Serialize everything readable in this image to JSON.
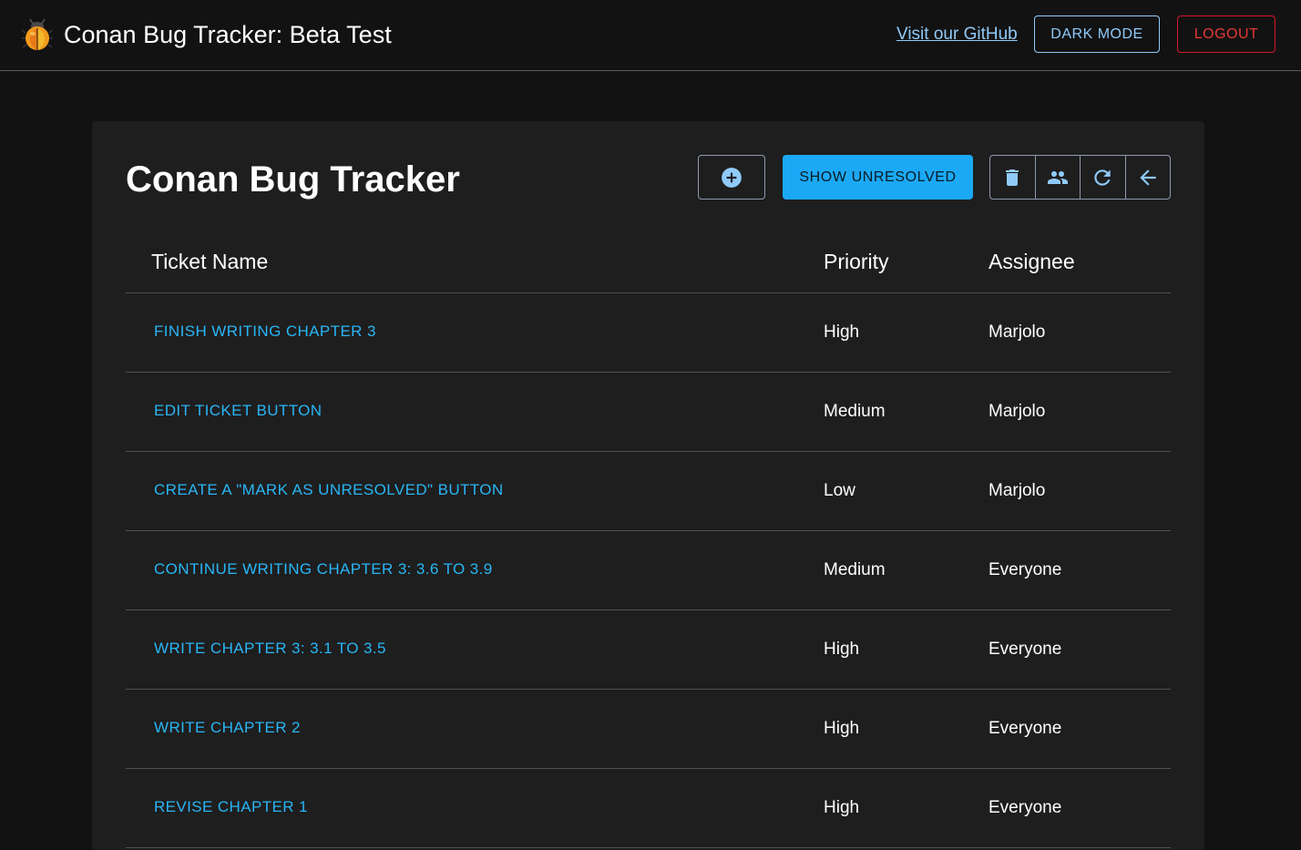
{
  "header": {
    "title": "Conan Bug Tracker: Beta Test",
    "github_link": "Visit our GitHub",
    "dark_mode_label": "DARK MODE",
    "logout_label": "LOGOUT"
  },
  "card": {
    "title": "Conan Bug Tracker",
    "show_unresolved_label": "SHOW UNRESOLVED",
    "toolbar_icons": [
      "add-circle-icon",
      "trash-icon",
      "people-icon",
      "refresh-icon",
      "arrow-back-icon"
    ]
  },
  "table": {
    "columns": [
      "Ticket Name",
      "Priority",
      "Assignee"
    ],
    "rows": [
      {
        "name": "FINISH WRITING CHAPTER 3",
        "priority": "High",
        "assignee": "Marjolo"
      },
      {
        "name": "EDIT TICKET BUTTON",
        "priority": "Medium",
        "assignee": "Marjolo"
      },
      {
        "name": "CREATE A \"MARK AS UNRESOLVED\" BUTTON",
        "priority": "Low",
        "assignee": "Marjolo"
      },
      {
        "name": "CONTINUE WRITING CHAPTER 3: 3.6 TO 3.9",
        "priority": "Medium",
        "assignee": "Everyone"
      },
      {
        "name": "WRITE CHAPTER 3: 3.1 TO 3.5",
        "priority": "High",
        "assignee": "Everyone"
      },
      {
        "name": "WRITE CHAPTER 2",
        "priority": "High",
        "assignee": "Everyone"
      },
      {
        "name": "REVISE CHAPTER 1",
        "priority": "High",
        "assignee": "Everyone"
      }
    ]
  },
  "colors": {
    "background": "#121212",
    "card": "#1e1e1e",
    "link": "#29b6f6",
    "primary": "#1ba9f5",
    "outline_blue": "#90caf9",
    "logout_red": "#e53935"
  }
}
